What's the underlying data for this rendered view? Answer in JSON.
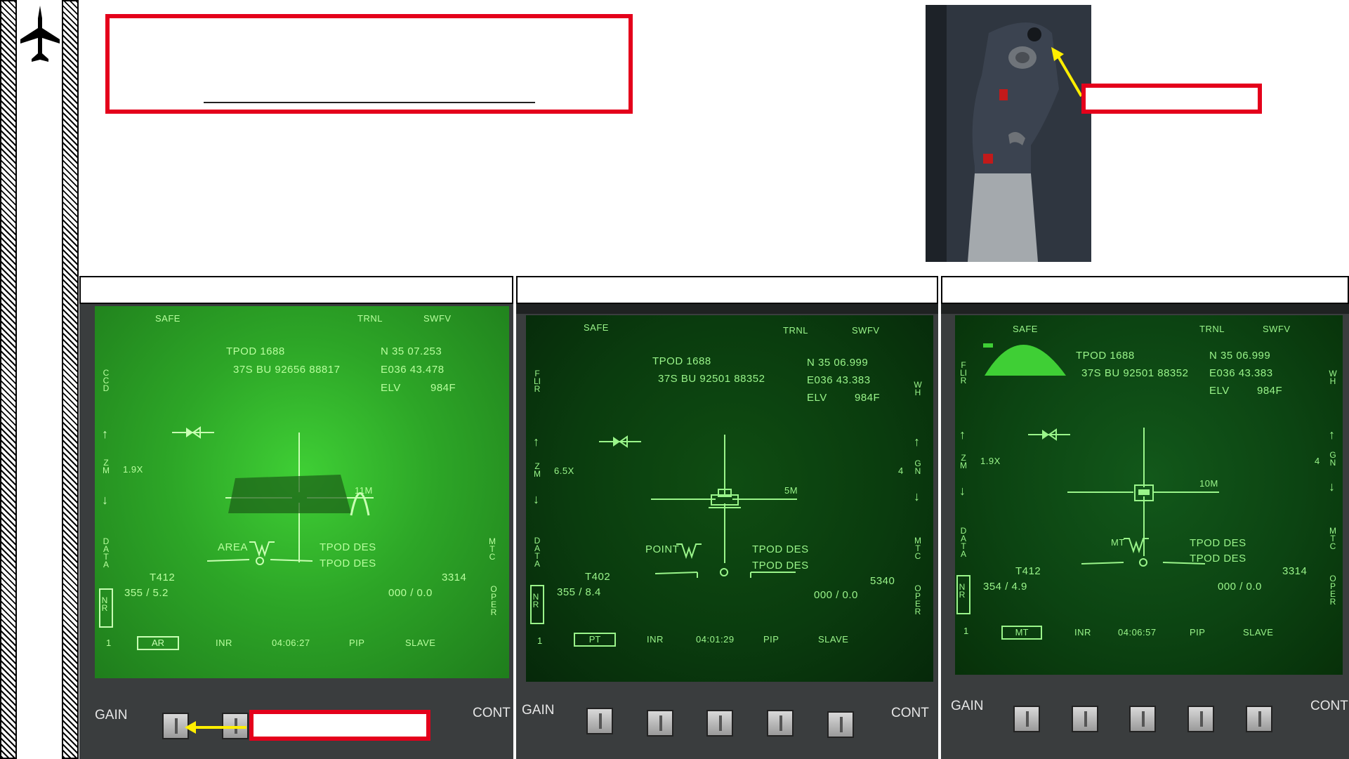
{
  "sidebar": {
    "aircraft_icon": "jet-aircraft-icon"
  },
  "colors": {
    "callout_red": "#e4001b",
    "pointer_yellow": "#ffee00",
    "hud_green": "#9af58a"
  },
  "panels": [
    {
      "caption": "",
      "top_left": "SAFE",
      "top_mid": "TRNL",
      "top_right": "SWFV",
      "tpod": "TPOD 1688",
      "grid": "37S BU 92656 88817",
      "lat": "N 35 07.253",
      "lon": "E036 43.478",
      "elv": "ELV",
      "elv_val": "984F",
      "left_mode": "CCD",
      "zm": "ZM",
      "zoom": "1.9X",
      "data": "DATA",
      "nr": "NR",
      "one": "1",
      "range_label": "11M",
      "track_mode": "AREA",
      "des1": "TPOD DES",
      "des2": "TPOD DES",
      "tgt": "T412",
      "hdg": "355 / 5.2",
      "alt": "3314",
      "brg": "000 / 0.0",
      "right1": "",
      "right2": "MTC",
      "right3": "OPER",
      "osb": [
        "AR",
        "INR",
        "04:06:27",
        "PIP",
        "SLAVE"
      ],
      "gain": "GAIN",
      "cont": "CONT"
    },
    {
      "caption": "",
      "top_left": "SAFE",
      "top_mid": "TRNL",
      "top_right": "SWFV",
      "tpod": "TPOD 1688",
      "grid": "37S BU 92501 88352",
      "lat": "N 35 06.999",
      "lon": "E036 43.383",
      "elv": "ELV",
      "elv_val": "984F",
      "left_mode": "FLIR",
      "zm": "ZM",
      "zoom": "6.5X",
      "data": "DATA",
      "nr": "NR",
      "one": "1",
      "range_label": "5M",
      "track_mode": "POINT",
      "des1": "TPOD DES",
      "des2": "TPOD DES",
      "tgt": "T402",
      "hdg": "355 / 8.4",
      "alt": "5340",
      "brg": "000 / 0.0",
      "right1": "WH",
      "right_gn": "GN",
      "right_num": "4",
      "right2": "MTC",
      "right3": "OPER",
      "osb": [
        "PT",
        "INR",
        "04:01:29",
        "PIP",
        "SLAVE"
      ],
      "gain": "GAIN",
      "cont": "CONT"
    },
    {
      "caption": "",
      "top_left": "SAFE",
      "top_mid": "TRNL",
      "top_right": "SWFV",
      "tpod": "TPOD 1688",
      "grid": "37S BU 92501 88352",
      "lat": "N 35 06.999",
      "lon": "E036 43.383",
      "elv": "ELV",
      "elv_val": "984F",
      "left_mode": "FLIR",
      "zm": "ZM",
      "zoom": "1.9X",
      "data": "DATA",
      "nr": "NR",
      "one": "1",
      "range_label": "10M",
      "track_mode": "MT",
      "des1": "TPOD DES",
      "des2": "TPOD DES",
      "tgt": "T412",
      "hdg": "354 / 4.9",
      "alt": "3314",
      "brg": "000 / 0.0",
      "right1": "WH",
      "right_gn": "GN",
      "right_num": "4",
      "right2": "MTC",
      "right3": "OPER",
      "osb": [
        "MT",
        "INR",
        "04:06:57",
        "PIP",
        "SLAVE"
      ],
      "gain": "GAIN",
      "cont": "CONT"
    }
  ]
}
